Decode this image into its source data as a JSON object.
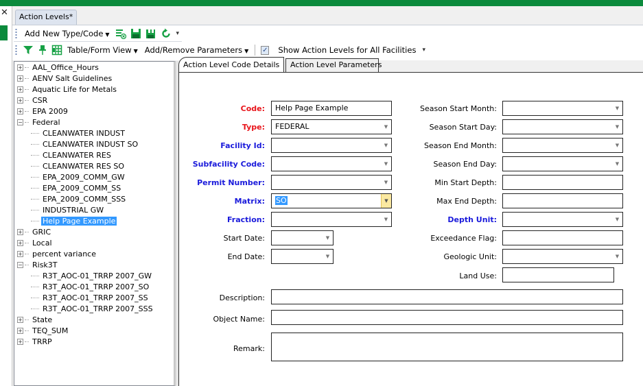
{
  "window": {
    "close_glyph": "✕",
    "doc_tab": "Action Levels*"
  },
  "toolbar1": {
    "add_new": "Add New Type/Code",
    "icons": [
      "clear-grid-icon",
      "save-icon",
      "save-all-icon",
      "refresh-icon"
    ]
  },
  "toolbar2": {
    "table_form_view": "Table/Form View",
    "add_remove_params": "Add/Remove Parameters",
    "show_all_checked": true,
    "show_all_label": "Show Action Levels for All Facilities"
  },
  "tree": [
    {
      "label": "AAL_Office_Hours",
      "expanded": false
    },
    {
      "label": "AENV Salt Guidelines",
      "expanded": false
    },
    {
      "label": "Aquatic Life for Metals",
      "expanded": false
    },
    {
      "label": "CSR",
      "expanded": false
    },
    {
      "label": "EPA 2009",
      "expanded": false
    },
    {
      "label": "Federal",
      "expanded": true,
      "children": [
        "CLEANWATER INDUST",
        "CLEANWATER INDUST SO",
        "CLEANWATER RES",
        "CLEANWATER RES SO",
        "EPA_2009_COMM_GW",
        "EPA_2009_COMM_SS",
        "EPA_2009_COMM_SSS",
        "INDUSTRIAL GW",
        "Help Page Example"
      ],
      "selected_child": "Help Page Example"
    },
    {
      "label": "GRIC",
      "expanded": false
    },
    {
      "label": "Local",
      "expanded": false
    },
    {
      "label": "percent variance",
      "expanded": false
    },
    {
      "label": "Risk3T",
      "expanded": true,
      "children": [
        "R3T_AOC-01_TRRP 2007_GW",
        "R3T_AOC-01_TRRP 2007_SO",
        "R3T_AOC-01_TRRP 2007_SS",
        "R3T_AOC-01_TRRP 2007_SSS"
      ]
    },
    {
      "label": "State",
      "expanded": false
    },
    {
      "label": "TEQ_SUM",
      "expanded": false
    },
    {
      "label": "TRRP",
      "expanded": false
    }
  ],
  "detail_tabs": [
    "Action Level Code Details",
    "Action Level Parameters"
  ],
  "form": {
    "code": {
      "label": "Code:",
      "value": "Help Page Example"
    },
    "type": {
      "label": "Type:",
      "value": "FEDERAL"
    },
    "facility_id": {
      "label": "Facility Id:",
      "value": ""
    },
    "subfacility_code": {
      "label": "Subfacility Code:",
      "value": ""
    },
    "permit_number": {
      "label": "Permit Number:",
      "value": ""
    },
    "matrix": {
      "label": "Matrix:",
      "value": "SO"
    },
    "fraction": {
      "label": "Fraction:",
      "value": ""
    },
    "start_date": {
      "label": "Start Date:",
      "value": ""
    },
    "end_date": {
      "label": "End Date:",
      "value": ""
    },
    "season_start_month": {
      "label": "Season Start Month:",
      "value": ""
    },
    "season_start_day": {
      "label": "Season Start Day:",
      "value": ""
    },
    "season_end_month": {
      "label": "Season End Month:",
      "value": ""
    },
    "season_end_day": {
      "label": "Season End Day:",
      "value": ""
    },
    "min_start_depth": {
      "label": "Min Start Depth:",
      "value": ""
    },
    "max_end_depth": {
      "label": "Max End Depth:",
      "value": ""
    },
    "depth_unit": {
      "label": "Depth Unit:",
      "value": ""
    },
    "exceedance_flag": {
      "label": "Exceedance Flag:",
      "value": ""
    },
    "geologic_unit": {
      "label": "Geologic Unit:",
      "value": ""
    },
    "land_use": {
      "label": "Land Use:",
      "value": ""
    },
    "description": {
      "label": "Description:",
      "value": ""
    },
    "object_name": {
      "label": "Object Name:",
      "value": ""
    },
    "remark": {
      "label": "Remark:",
      "value": ""
    }
  },
  "colors": {
    "brand_green": "#0b8a3c",
    "required_label": "#e8141a",
    "key_label": "#1a1adb",
    "selection": "#3399ff"
  }
}
